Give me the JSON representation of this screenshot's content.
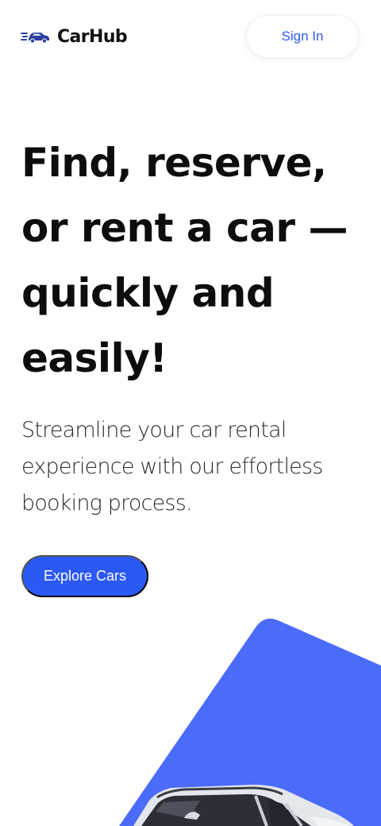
{
  "brand": {
    "name": "CarHub",
    "logo_icon": "car-icon",
    "accent_color": "#2b59f5",
    "shape_color": "#4b6bfb"
  },
  "header": {
    "sign_in_label": "Sign In"
  },
  "hero": {
    "title_lines": [
      "Find, reserve,",
      "or rent a car —",
      "quickly and",
      "easily!"
    ],
    "subtitle_lines": [
      "Streamline your car rental",
      "experience with our effortless",
      "booking process."
    ],
    "cta_label": "Explore Cars",
    "image_icon": "car-image"
  }
}
